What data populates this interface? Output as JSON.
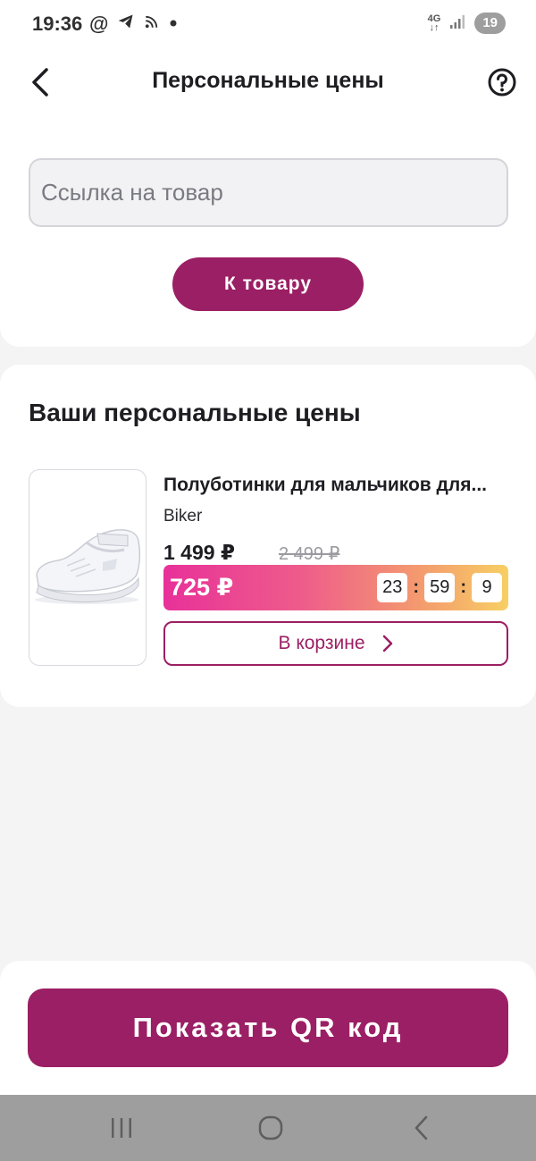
{
  "status_bar": {
    "time": "19:36",
    "left_icons": [
      "at-icon",
      "telegram-icon",
      "cast-icon",
      "dot-icon"
    ],
    "network": "4G",
    "notification_count": "19"
  },
  "header": {
    "title": "Персональные цены",
    "back_icon": "chevron-left-icon",
    "help_icon": "question-circle-icon"
  },
  "search": {
    "placeholder": "Ссылка на товар",
    "value": ""
  },
  "to_product_label": "К товару",
  "personal_prices": {
    "title": "Ваши персональные цены",
    "items": [
      {
        "name": "Полуботинки для мальчиков для...",
        "brand": "Biker",
        "price": "1 499 ₽",
        "old_price": "2 499 ₽",
        "personal_price": "725 ₽",
        "timer": {
          "hours": "23",
          "minutes": "59",
          "seconds": "9"
        },
        "cart_label": "В корзине",
        "image": "white-sneaker-image"
      }
    ]
  },
  "qr_button_label": "Показать QR код",
  "nav": {
    "recents_icon": "recents-icon",
    "home_icon": "home-icon",
    "back_icon": "back-icon"
  },
  "colors": {
    "accent": "#9b1f64",
    "promo_gradient_start": "#e8319a",
    "promo_gradient_end": "#f7cf63",
    "background": "#f4f4f5"
  }
}
